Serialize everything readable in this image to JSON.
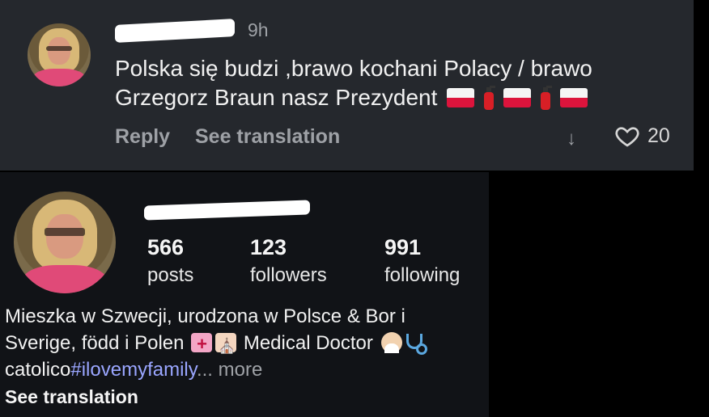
{
  "comment": {
    "time": "9h",
    "text_line1": "Polska się budzi ,brawo kochani Polacy / brawo",
    "text_line2": "Grzegorz Braun nasz Prezydent",
    "reply_label": "Reply",
    "see_translation_label": "See translation",
    "like_count": "20"
  },
  "profile": {
    "stats": [
      {
        "value": "566",
        "label": "posts"
      },
      {
        "value": "123",
        "label": "followers"
      },
      {
        "value": "991",
        "label": "following"
      }
    ],
    "bio_line1": "Mieszka w Szwecji, urodzona w Polsce & Bor i",
    "bio_line2_a": "Sverige, född i Polen",
    "bio_line2_b": "Medical Doctor",
    "bio_line3_a": "catolico",
    "bio_hashtag": "#ilovemyfamily",
    "bio_more": "... more",
    "see_translation_label": "See translation"
  },
  "icons": {
    "flag": "poland-flag-icon",
    "extinguisher": "fire-extinguisher-icon",
    "heart": "heart-icon",
    "down_arrow": "down-arrow-icon"
  },
  "colors": {
    "comment_bg": "#25282d",
    "profile_bg": "#111317",
    "hashtag": "#9aa6ff"
  }
}
